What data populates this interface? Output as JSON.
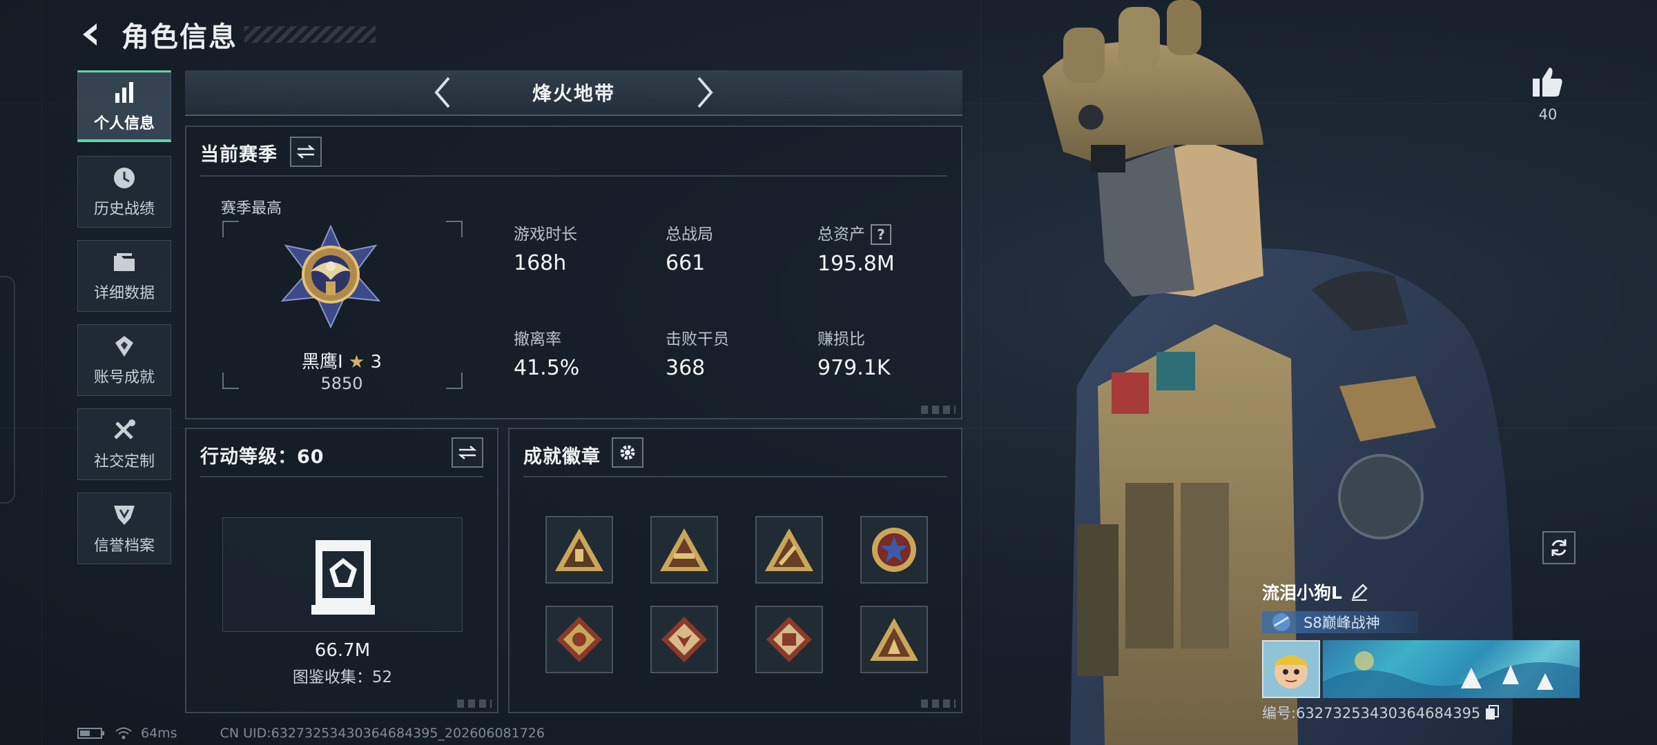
{
  "header": {
    "title": "角色信息"
  },
  "sidebar": {
    "items": [
      {
        "label": "个人信息",
        "active": true,
        "icon": "bar-chart-icon"
      },
      {
        "label": "历史战绩",
        "active": false,
        "icon": "clock-icon"
      },
      {
        "label": "详细数据",
        "active": false,
        "icon": "folder-icon"
      },
      {
        "label": "账号成就",
        "active": false,
        "icon": "trophy-icon"
      },
      {
        "label": "社交定制",
        "active": false,
        "icon": "tools-icon"
      },
      {
        "label": "信誉档案",
        "active": false,
        "icon": "shield-icon"
      }
    ]
  },
  "mode_bar": {
    "name": "烽火地带"
  },
  "season": {
    "title": "当前赛季",
    "best_label": "赛季最高",
    "rank_name": "黑鹰I",
    "rank_stars": "3",
    "rank_points": "5850",
    "stats": [
      {
        "label": "游戏时长",
        "value": "168h"
      },
      {
        "label": "总战局",
        "value": "661"
      },
      {
        "label": "总资产",
        "value": "195.8M",
        "help": "?"
      },
      {
        "label": "撤离率",
        "value": "41.5%"
      },
      {
        "label": "击败干员",
        "value": "368"
      },
      {
        "label": "赚损比",
        "value": "979.1K"
      }
    ]
  },
  "action_level": {
    "title": "行动等级：60",
    "value": "66.7M",
    "collection": "图鉴收集：52"
  },
  "badges": {
    "title": "成就徽章",
    "count": 8
  },
  "like": {
    "count": "40"
  },
  "player": {
    "name": "流泪小狗L",
    "title": "S8巅峰战神",
    "id": "编号:6327325343036468439­5"
  },
  "status": {
    "ping": "64ms",
    "uid": "CN UID:6327325343036468439­5_202606081726"
  },
  "colors": {
    "accent": "#5fd6a6",
    "panel_border": "#5b6b78",
    "gold": "#c9a75a"
  }
}
